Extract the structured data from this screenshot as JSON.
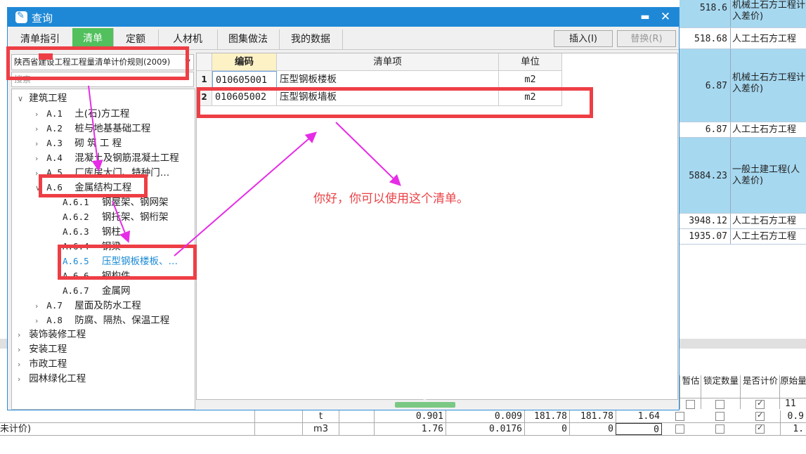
{
  "window": {
    "title": "查询",
    "maximize_icon": "maximize-icon",
    "close_icon": "close-icon"
  },
  "tabs": [
    {
      "label": "清单指引"
    },
    {
      "label": "清单",
      "active": true
    },
    {
      "label": "定额"
    },
    {
      "label": "人材机"
    },
    {
      "label": "图集做法"
    },
    {
      "label": "我的数据"
    }
  ],
  "toolbar": {
    "insert_label": "插入(I)",
    "replace_label": "替换(R)"
  },
  "library_select": {
    "value": "陕西省建设工程工程量清单计价规则(2009)"
  },
  "search": {
    "placeholder": "搜索"
  },
  "tree": [
    {
      "code": "",
      "label": "建筑工程",
      "level": 0,
      "expanded": true
    },
    {
      "code": "A.1",
      "label": "土(石)方工程",
      "level": 1
    },
    {
      "code": "A.2",
      "label": "桩与地基基础工程",
      "level": 1
    },
    {
      "code": "A.3",
      "label": "砌 筑 工 程",
      "level": 1
    },
    {
      "code": "A.4",
      "label": "混凝土及钢筋混凝土工程",
      "level": 1
    },
    {
      "code": "A.5",
      "label": "厂库房大门、特种门…",
      "level": 1
    },
    {
      "code": "A.6",
      "label": "金属结构工程",
      "level": 1,
      "expanded": true
    },
    {
      "code": "A.6.1",
      "label": "钢屋架、钢网架",
      "level": 2
    },
    {
      "code": "A.6.2",
      "label": "钢托架、钢桁架",
      "level": 2
    },
    {
      "code": "A.6.3",
      "label": "钢柱",
      "level": 2
    },
    {
      "code": "A.6.4",
      "label": "钢梁",
      "level": 2
    },
    {
      "code": "A.6.5",
      "label": "压型钢板楼板、…",
      "level": 2,
      "selected": true
    },
    {
      "code": "A.6.6",
      "label": "钢构件",
      "level": 2
    },
    {
      "code": "A.6.7",
      "label": "金属网",
      "level": 2
    },
    {
      "code": "A.7",
      "label": "屋面及防水工程",
      "level": 1
    },
    {
      "code": "A.8",
      "label": "防腐、隔热、保温工程",
      "level": 1
    },
    {
      "code": "",
      "label": "装饰装修工程",
      "level": 0
    },
    {
      "code": "",
      "label": "安装工程",
      "level": 0
    },
    {
      "code": "",
      "label": "市政工程",
      "level": 0
    },
    {
      "code": "",
      "label": "园林绿化工程",
      "level": 0
    }
  ],
  "grid": {
    "headers": [
      "编码",
      "清单项",
      "单位"
    ],
    "rows": [
      {
        "num": "1",
        "code": "010605001",
        "name": "压型钢板楼板",
        "unit": "m2"
      },
      {
        "num": "2",
        "code": "010605002",
        "name": "压型钢板墙板",
        "unit": "m2"
      }
    ]
  },
  "annotation": {
    "note": "你好，你可以使用这个清单。"
  },
  "background": {
    "right_rows": [
      {
        "value": "518.6",
        "desc": "机械土石方工程计入差价)",
        "color": "blue"
      },
      {
        "value": "518.68",
        "desc": "人工土石方工程",
        "color": "white"
      },
      {
        "value": "6.87",
        "desc": "机械土石方工程计入差价)",
        "color": "blue"
      },
      {
        "value": "6.87",
        "desc": "人工土石方工程",
        "color": "white"
      },
      {
        "value": "5884.23",
        "desc": "一般土建工程(人入差价)",
        "color": "blue"
      },
      {
        "value": "3948.12",
        "desc": "人工土石方工程",
        "color": "white"
      },
      {
        "value": "1935.07",
        "desc": "人工土石方工程",
        "color": "white"
      }
    ],
    "headers": [
      "暂估",
      "锁定数量",
      "是否计价",
      "原始量"
    ],
    "rows": [
      {
        "col1": "",
        "unit": "t",
        "v1": "0.901",
        "v2": "0.009",
        "v3": "181.78",
        "v4": "181.78",
        "v5": "1.64",
        "last": "0.9"
      },
      {
        "col1": "未计价)",
        "unit": "m3",
        "v1": "1.76",
        "v2": "0.0176",
        "v3": "0",
        "v4": "0",
        "v5": "0",
        "last": "1."
      }
    ],
    "partial_top_value": "11"
  }
}
